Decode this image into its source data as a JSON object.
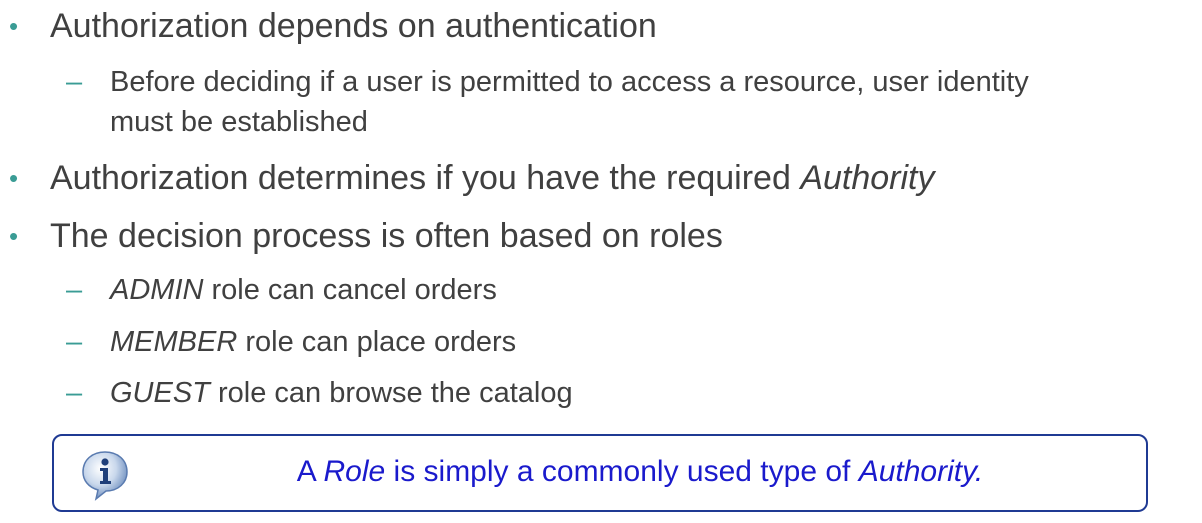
{
  "bullets": [
    {
      "text": "Authorization depends on authentication",
      "sub": [
        {
          "line1": "Before deciding if a user is permitted to access a resource, user identity",
          "line2": "must be established"
        }
      ]
    },
    {
      "text_plain": "Authorization determines if you have the required ",
      "text_italic": "Authority"
    },
    {
      "text": "The decision process is often based on roles",
      "sub": [
        {
          "italic": "ADMIN",
          "rest": " role can cancel orders"
        },
        {
          "italic": "MEMBER",
          "rest": " role can place orders"
        },
        {
          "italic": "GUEST",
          "rest": " role can browse the catalog"
        }
      ]
    }
  ],
  "bullet_glyph": "•",
  "dash_glyph": "–",
  "note": {
    "icon": "info-icon",
    "part1": "A ",
    "part2_italic": "Role",
    "part3": " is simply a commonly used type of ",
    "part4_italic": "Authority.",
    "text_color": "#1a1acc",
    "border_color": "#1f3a93"
  },
  "colors": {
    "bullet": "#3a9c95",
    "text": "#404040"
  }
}
